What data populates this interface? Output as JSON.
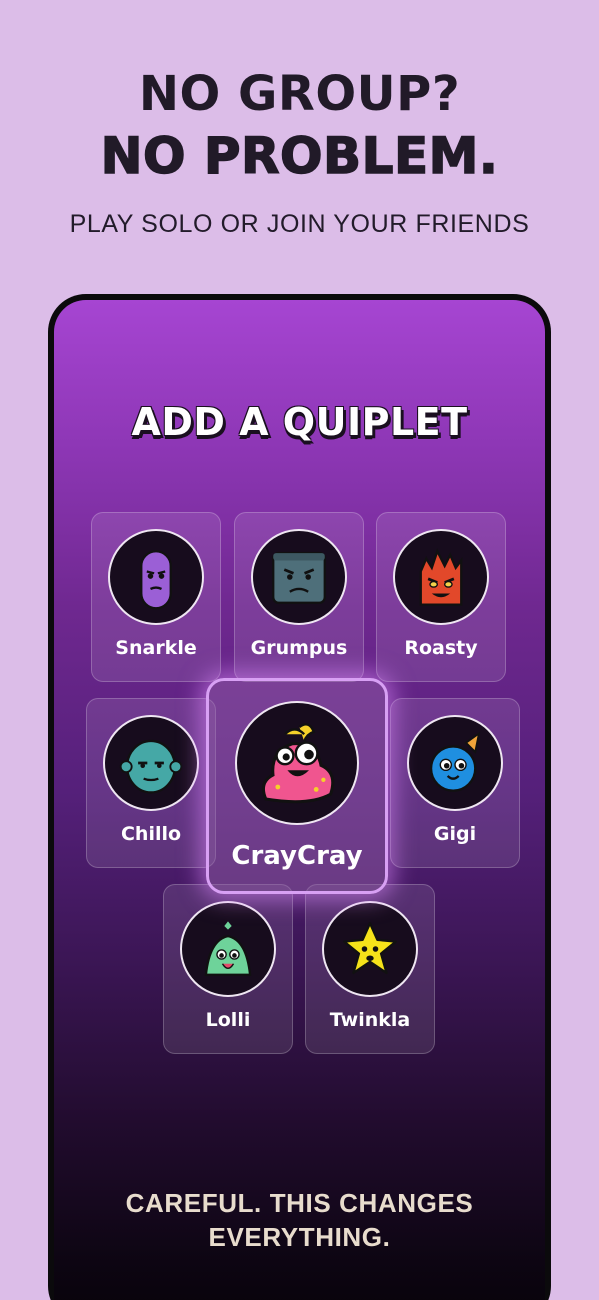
{
  "headline": {
    "line1": "NO GROUP?",
    "line2": "NO PROBLEM.",
    "subtitle": "PLAY SOLO OR JOIN YOUR FRIENDS"
  },
  "screen": {
    "title": "ADD A QUIPLET",
    "footer_line1": "CAREFUL. THIS CHANGES",
    "footer_line2": "EVERYTHING."
  },
  "quiplets": [
    {
      "name": "Snarkle",
      "icon": "snarkle-avatar-icon",
      "color": "#9b5fd6"
    },
    {
      "name": "Grumpus",
      "icon": "grumpus-avatar-icon",
      "color": "#4e6f7a"
    },
    {
      "name": "Roasty",
      "icon": "roasty-avatar-icon",
      "color": "#e2482a"
    },
    {
      "name": "Chillo",
      "icon": "chillo-avatar-icon",
      "color": "#45a8a6"
    },
    {
      "name": "CrayCray",
      "icon": "craycray-avatar-icon",
      "color": "#f0558f",
      "selected": true
    },
    {
      "name": "Gigi",
      "icon": "gigi-avatar-icon",
      "color": "#1f8fe0"
    },
    {
      "name": "Lolli",
      "icon": "lolli-avatar-icon",
      "color": "#6ed39a"
    },
    {
      "name": "Twinkla",
      "icon": "twinkla-avatar-icon",
      "color": "#f5e21a"
    }
  ],
  "colors": {
    "background": "#dcbde8",
    "screen_top": "#a645d2",
    "screen_bottom": "#070309",
    "selected_glow": "#d8a0f4"
  }
}
